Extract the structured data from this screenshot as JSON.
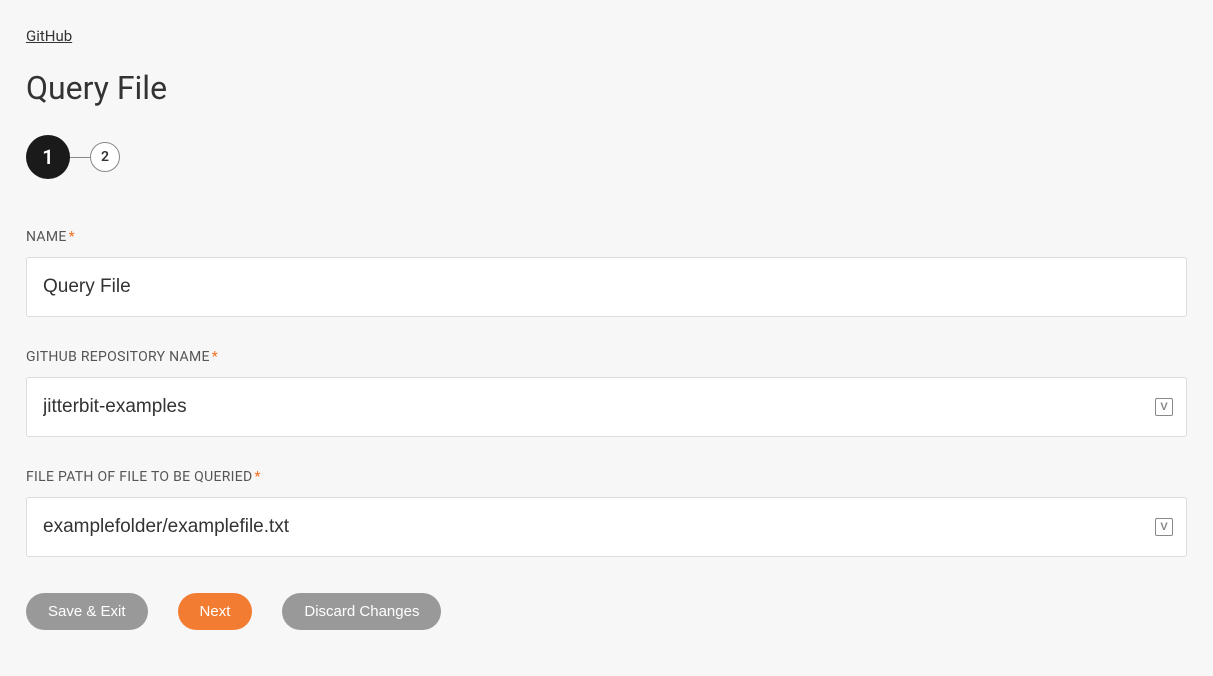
{
  "breadcrumb": {
    "label": "GitHub"
  },
  "page": {
    "title": "Query File"
  },
  "stepper": {
    "step1": "1",
    "step2": "2"
  },
  "form": {
    "name": {
      "label": "NAME",
      "value": "Query File"
    },
    "repo": {
      "label": "GITHUB REPOSITORY NAME",
      "value": "jitterbit-examples"
    },
    "filepath": {
      "label": "FILE PATH OF FILE TO BE QUERIED",
      "value": "examplefolder/examplefile.txt"
    }
  },
  "buttons": {
    "save_exit": "Save & Exit",
    "next": "Next",
    "discard": "Discard Changes"
  },
  "icons": {
    "variable_glyph": "V"
  }
}
